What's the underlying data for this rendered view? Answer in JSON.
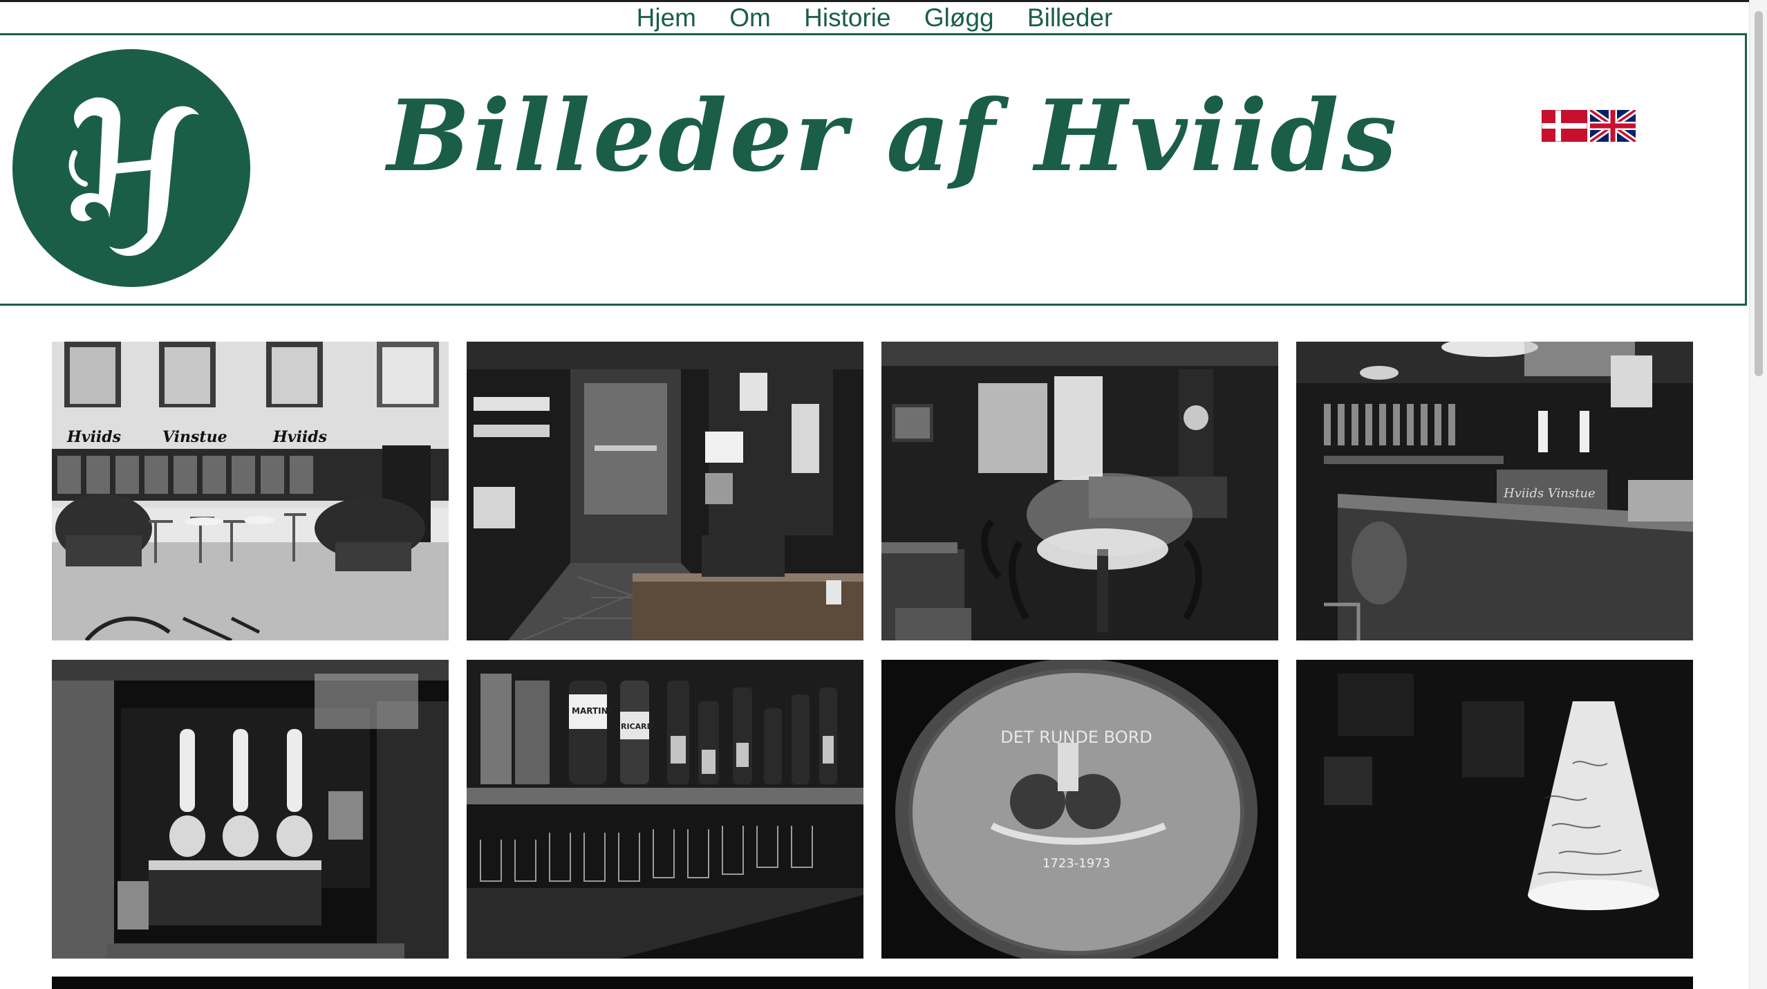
{
  "nav": {
    "items": [
      "Hjem",
      "Om",
      "Historie",
      "Gløgg",
      "Billeder"
    ]
  },
  "header": {
    "title": "Billeder af Hviids",
    "logo_letter": "H",
    "languages": [
      "danish-flag",
      "british-flag"
    ]
  },
  "colors": {
    "brand": "#1a5e48",
    "background": "#ffffff"
  },
  "gallery": {
    "photos": [
      {
        "sign_left": "Hviids",
        "sign_mid": "Vinstue",
        "sign_right": "Hviids"
      },
      {},
      {},
      {
        "bar_sign": "Hviids Vinstue"
      },
      {},
      {
        "bottle_labels": [
          "MARTINI",
          "RICARD"
        ]
      },
      {
        "table_text": "DET RUNDE BORD",
        "years": "1723-1973"
      },
      {}
    ]
  }
}
